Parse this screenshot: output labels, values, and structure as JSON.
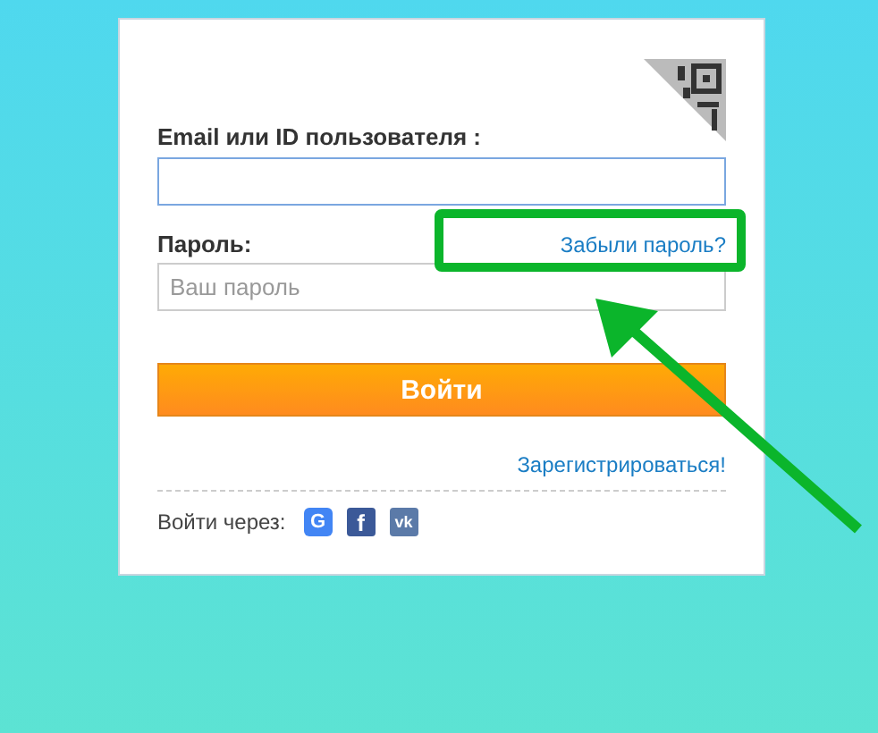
{
  "login": {
    "email_label": "Email или ID пользователя :",
    "password_label": "Пароль:",
    "forgot_link": "Забыли пароль?",
    "password_placeholder": "Ваш пароль",
    "submit": "Войти",
    "register_link": "Зарегистрироваться!",
    "social_label": "Войти через:",
    "social": [
      {
        "kind": "google",
        "label": "G",
        "color": "#4285f4"
      },
      {
        "kind": "facebook",
        "label": "f",
        "color": "#3b5998"
      },
      {
        "kind": "vk",
        "label": "vk",
        "color": "#5b7aa8"
      }
    ]
  }
}
